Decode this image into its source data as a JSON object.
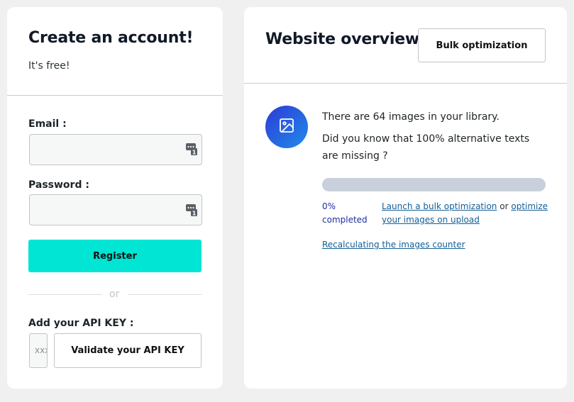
{
  "signup": {
    "title": "Create an account!",
    "subtitle": "It's free!",
    "email_label": "Email :",
    "email_value": "",
    "password_label": "Password :",
    "password_value": "",
    "register_label": "Register",
    "or_label": "or",
    "api_key_label": "Add your API KEY :",
    "api_key_placeholder": "xxxxxxxxxxxxxxxx",
    "validate_label": "Validate your API KEY"
  },
  "overview": {
    "title": "Website overview",
    "bulk_button_label": "Bulk optimization",
    "images_count_text": "There are 64 images in your library.",
    "alt_missing_text": "Did you know that 100% alternative texts are missing ?",
    "progress_fraction": 0,
    "progress_text": "0% completed",
    "launch_link": "Launch a bulk optimization",
    "connector_text": "or",
    "upload_link": "optimize your images on upload",
    "recalc_link": "Recalculating the images counter"
  },
  "icons": {
    "field_icon": "password-manager-key-icon",
    "overview_icon": "image-icon"
  },
  "colors": {
    "accent": "#00e5d4",
    "progress_fill": "#2a3ccc",
    "progress_track": "#c9d0dc",
    "link": "#135e96",
    "icon_gradient_start": "#2e3ad6",
    "icon_gradient_end": "#1f8bea"
  }
}
